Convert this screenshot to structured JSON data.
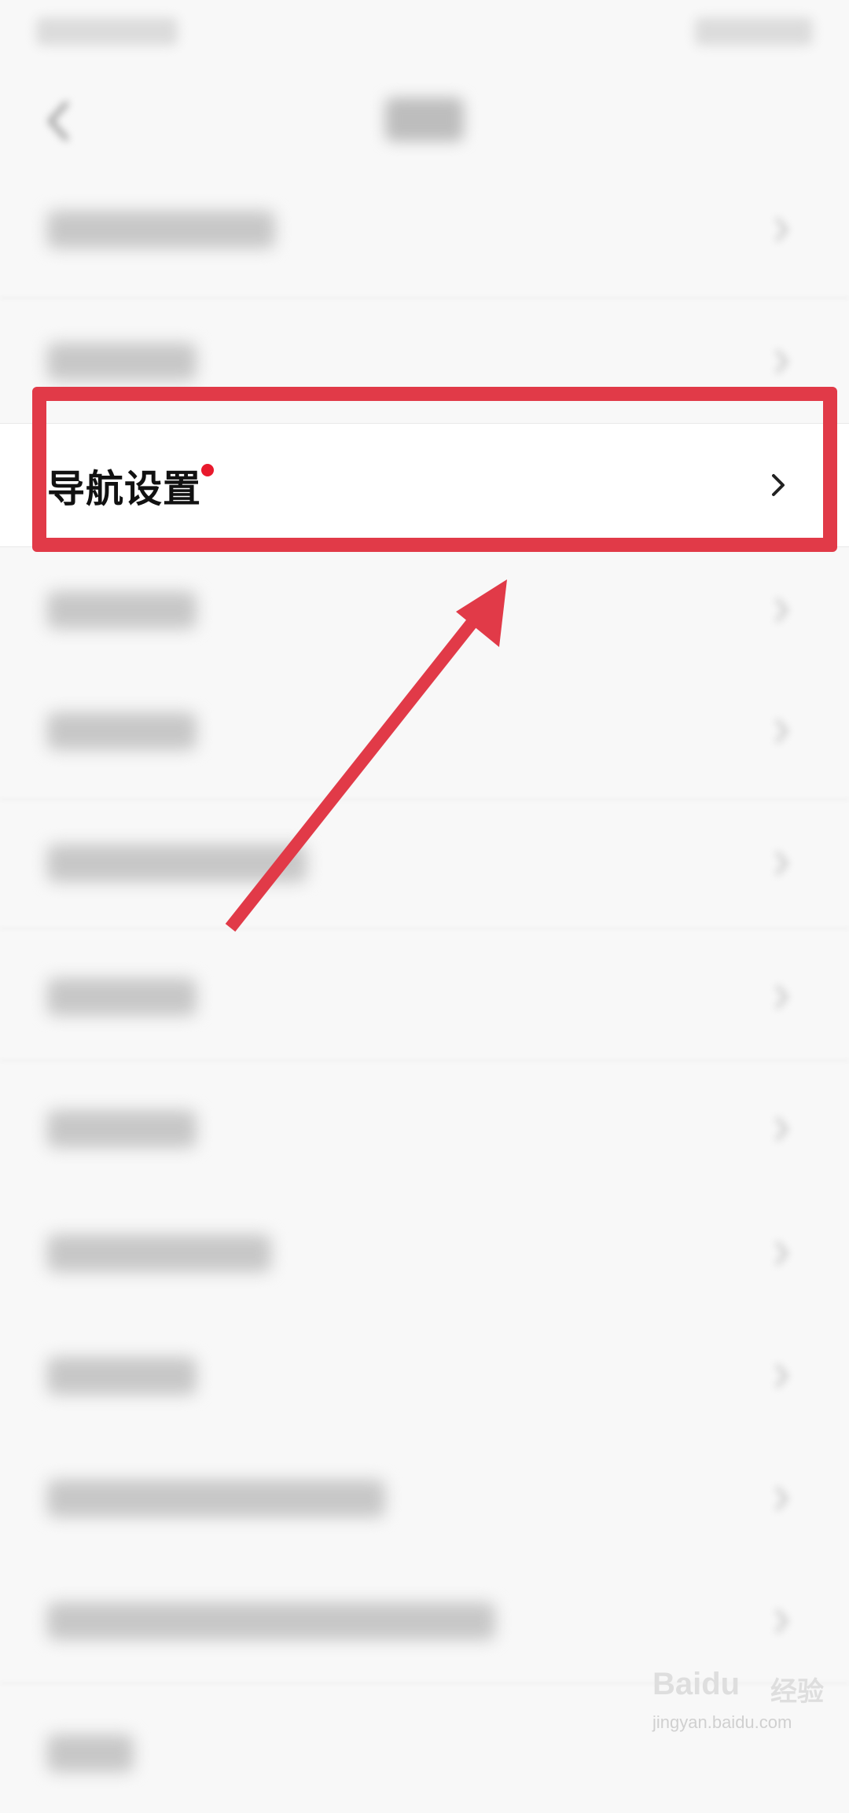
{
  "nav_settings": {
    "label": "导航设置",
    "has_badge": true
  },
  "blurred_rows_count": 12,
  "colors": {
    "highlight": "#e13a48",
    "badge": "#e8192c",
    "background": "#f8f8f8"
  },
  "icons": {
    "back": "chevron-left-icon",
    "row_chevron": "chevron-right-icon"
  },
  "watermark": {
    "brand": "Baidu",
    "product": "经验",
    "url": "jingyan.baidu.com"
  }
}
